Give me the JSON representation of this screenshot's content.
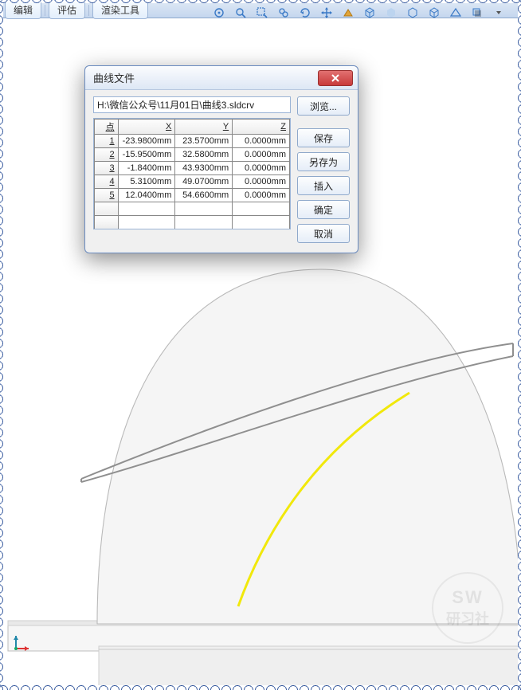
{
  "ribbon": {
    "tabs": [
      "编辑",
      "评估",
      "渲染工具"
    ]
  },
  "toolbar_icons": [
    "view-orientation-icon",
    "zoom-fit-icon",
    "zoom-area-icon",
    "zoom-dynamic-icon",
    "rotate-icon",
    "pan-icon",
    "section-icon",
    "shaded-edges-icon",
    "shaded-icon",
    "hidden-removed-icon",
    "wireframe-icon",
    "perspective-icon",
    "shadow-icon"
  ],
  "dialog": {
    "title": "曲线文件",
    "path": "H:\\微信公众号\\11月01日\\曲线3.sldcrv",
    "columns": {
      "point": "点",
      "x": "X",
      "y": "Y",
      "z": "Z"
    },
    "rows": [
      {
        "i": "1",
        "x": "-23.9800mm",
        "y": "23.5700mm",
        "z": "0.0000mm"
      },
      {
        "i": "2",
        "x": "-15.9500mm",
        "y": "32.5800mm",
        "z": "0.0000mm"
      },
      {
        "i": "3",
        "x": "-1.8400mm",
        "y": "43.9300mm",
        "z": "0.0000mm"
      },
      {
        "i": "4",
        "x": "5.3100mm",
        "y": "49.0700mm",
        "z": "0.0000mm"
      },
      {
        "i": "5",
        "x": "12.0400mm",
        "y": "54.6600mm",
        "z": "0.0000mm"
      }
    ],
    "buttons": {
      "browse": "浏览...",
      "save": "保存",
      "saveas": "另存为",
      "insert": "插入",
      "ok": "确定",
      "cancel": "取消"
    }
  },
  "watermark": {
    "line1": "SW",
    "line2": "研习社"
  }
}
